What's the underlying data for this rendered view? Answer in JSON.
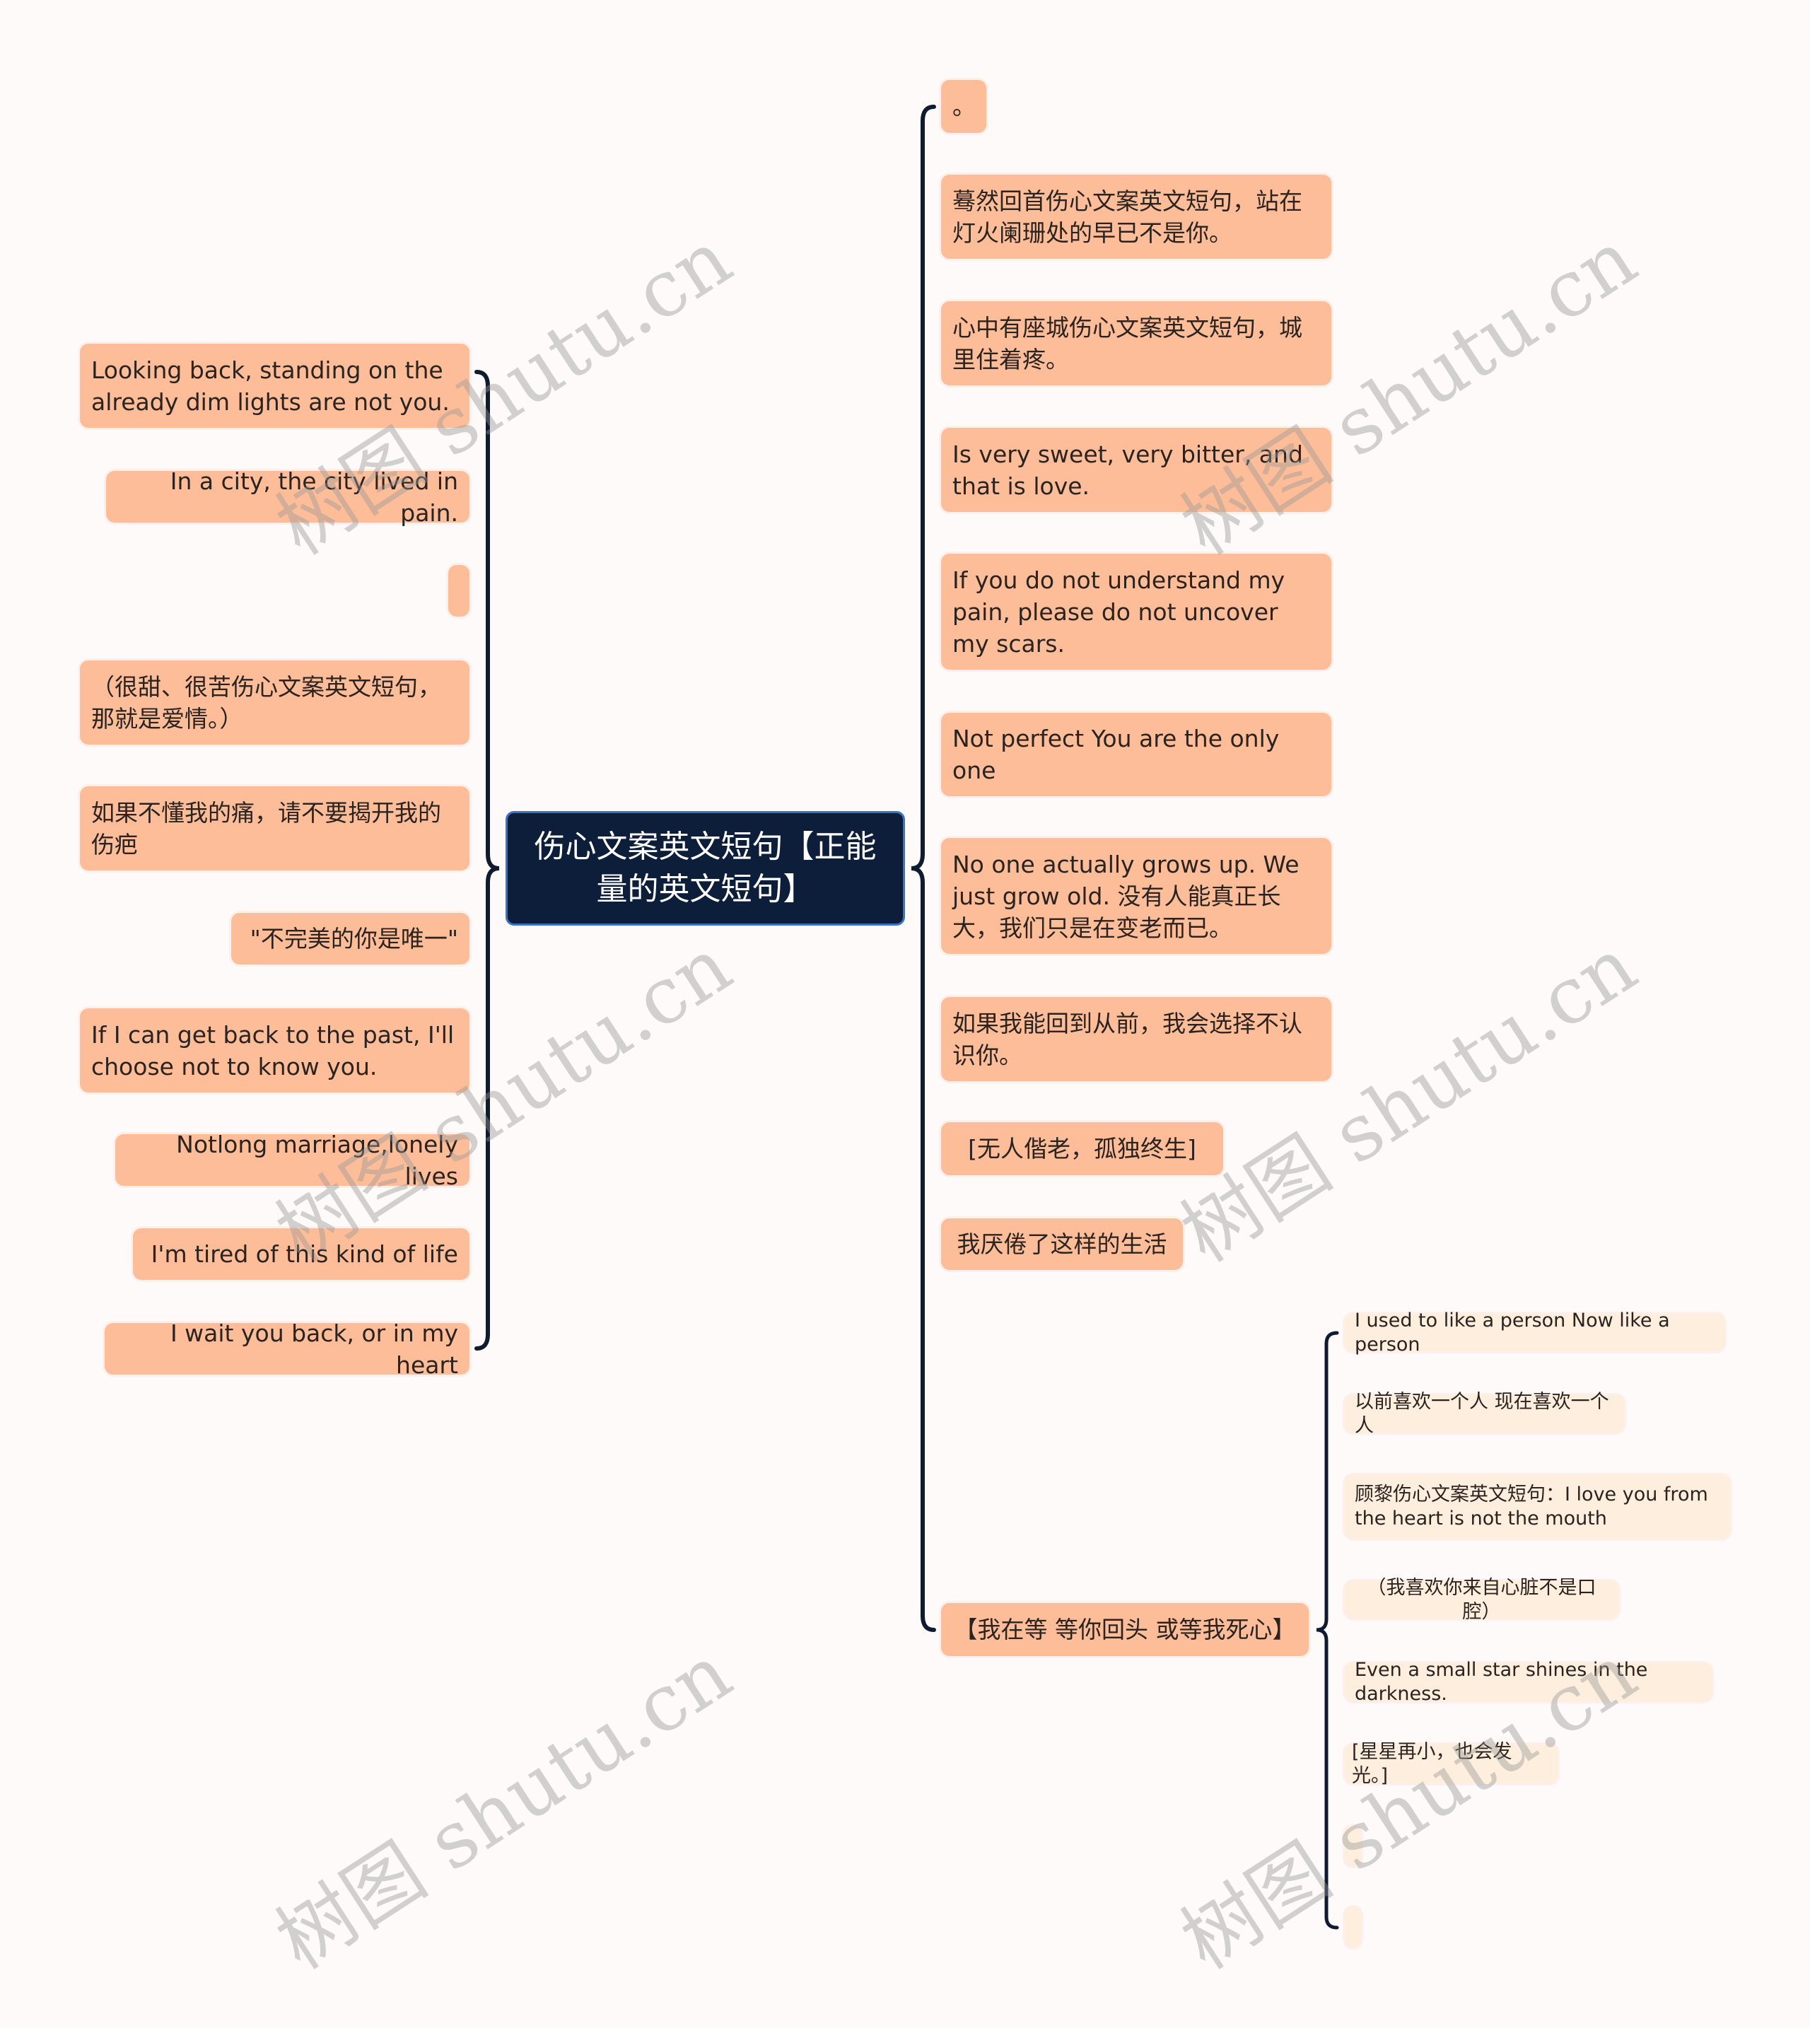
{
  "root": {
    "title": "伤心文案英文短句【正能量的英文短句】"
  },
  "left_branch": {
    "items": [
      {
        "text": "Looking back, standing on the already dim lights are not you."
      },
      {
        "text": "In a city, the city lived in pain."
      },
      {
        "text": ""
      },
      {
        "text": "（很甜、很苦伤心文案英文短句，那就是爱情。）"
      },
      {
        "text": "如果不懂我的痛，请不要揭开我的伤疤"
      },
      {
        "text": "\"不完美的你是唯一\""
      },
      {
        "text": "If I can get back to the past, I'll choose not to know you."
      },
      {
        "text": "Notlong marriage,lonely lives"
      },
      {
        "text": "I'm tired of this kind of life"
      },
      {
        "text": "I wait you back, or in my heart"
      }
    ]
  },
  "right_branch": {
    "items": [
      {
        "text": "。"
      },
      {
        "text": "蓦然回首伤心文案英文短句，站在灯火阑珊处的早已不是你。"
      },
      {
        "text": "心中有座城伤心文案英文短句，城里住着疼。"
      },
      {
        "text": "Is very sweet, very bitter, and that is love."
      },
      {
        "text": "If you do not understand my pain, please do not uncover my scars."
      },
      {
        "text": "Not perfect You are the only one"
      },
      {
        "text": "No one actually grows up. We just grow old. 没有人能真正长大，我们只是在变老而已。"
      },
      {
        "text": "如果我能回到从前，我会选择不认识你。"
      },
      {
        "text": "[无人偕老，孤独终生]"
      },
      {
        "text": "我厌倦了这样的生活"
      },
      {
        "text": "【我在等 等你回头 或等我死心】"
      }
    ]
  },
  "sub_branch": {
    "parent": "【我在等 等你回头 或等我死心】",
    "items": [
      {
        "text": "I used to like a person Now like a person"
      },
      {
        "text": "以前喜欢一个人 现在喜欢一个人"
      },
      {
        "text": "顾黎伤心文案英文短句：I love you from the heart is not the mouth"
      },
      {
        "text": "（我喜欢你来自心脏不是口腔）"
      },
      {
        "text": "Even a small star shines in the darkness."
      },
      {
        "text": "[星星再小，也会发光。]"
      },
      {
        "text": ""
      },
      {
        "text": ""
      }
    ]
  },
  "watermark": {
    "text": "树图 shutu.cn"
  },
  "colors": {
    "background": "#fdfaf9",
    "node_fill": "#fdbd99",
    "sub_node_fill": "#fdeedd",
    "root_fill": "#0d1e3a",
    "root_border": "#3b73c4",
    "connector": "#0f1b2e"
  }
}
